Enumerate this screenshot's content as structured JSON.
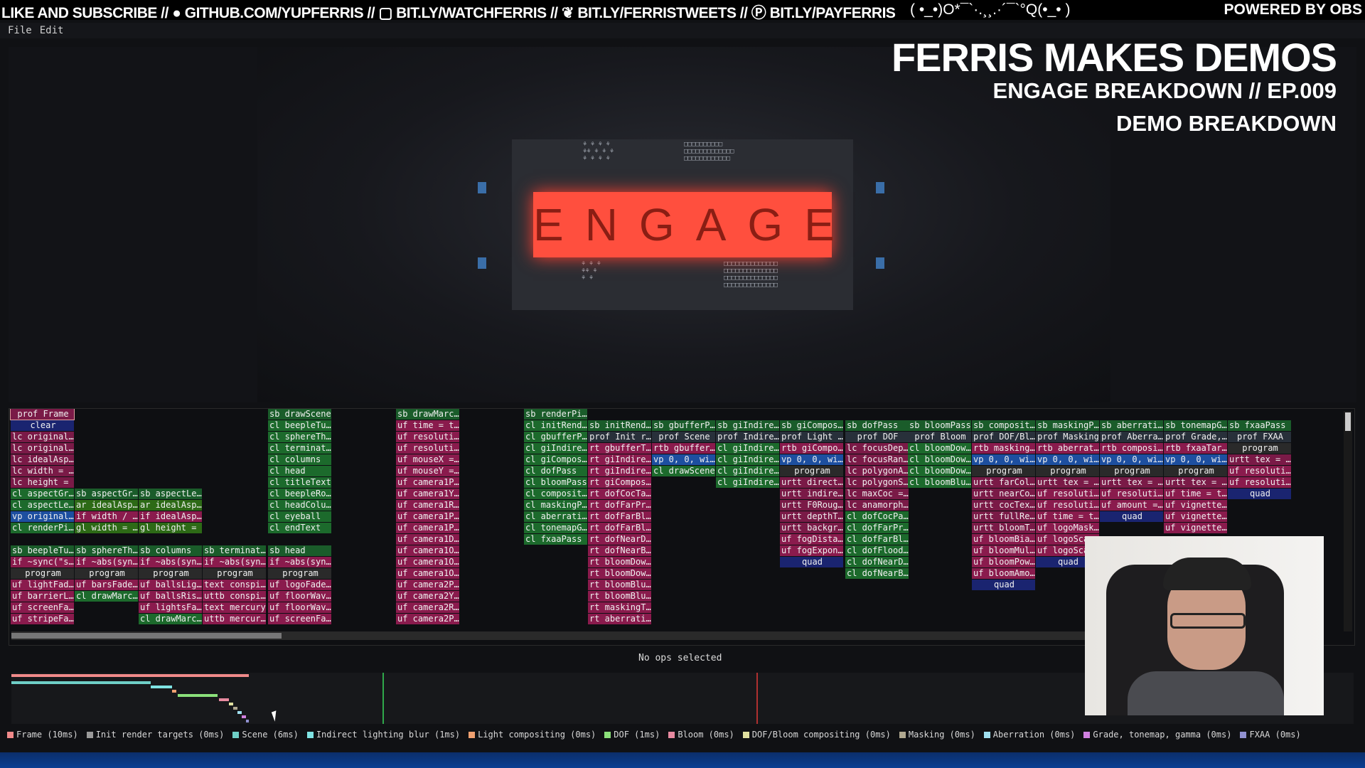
{
  "stream": {
    "left": "LIKE AND SUBSCRIBE // ● GITHUB.COM/YUPFERRIS // ▢ BIT.LY/WATCHFERRIS // ❦ BIT.LY/FERRISTWEETS // Ⓟ BIT.LY/PAYFERRIS",
    "center": "( •_•)O*¯`·.¸¸.·´¯`°Q(•_• )",
    "right": "POWERED BY OBS"
  },
  "menu": {
    "file": "File",
    "edit": "Edit"
  },
  "overlay": {
    "title": "FERRIS MAKES DEMOS",
    "subtitle": "ENGAGE BREAKDOWN // EP.009",
    "section": "DEMO BREAKDOWN"
  },
  "preview": {
    "logo": "ENGAGE"
  },
  "profiler": {
    "columns": [
      {
        "cells": [
          [
            "pf",
            "prof Frame"
          ],
          [
            "clear",
            "clear"
          ],
          [
            "lc",
            "lc original…"
          ],
          [
            "lc",
            "lc original…"
          ],
          [
            "lc",
            "lc idealAsp…"
          ],
          [
            "lc",
            "lc width = …"
          ],
          [
            "lc",
            "lc height = …"
          ],
          [
            "cl",
            "cl aspectGr…"
          ],
          [
            "cl",
            "cl aspectLe…"
          ],
          [
            "vp",
            "vp original…"
          ],
          [
            "cl",
            "cl renderPi…"
          ],
          [
            "blank",
            ""
          ],
          [
            "sb",
            "sb beepleTu…"
          ],
          [
            "uf",
            "if ~sync(\"s…"
          ],
          [
            "prog",
            "program"
          ],
          [
            "uf",
            "uf lightFad…"
          ],
          [
            "uf",
            "uf barrierL…"
          ],
          [
            "uf",
            "uf screenFa…"
          ],
          [
            "uf",
            "uf stripeFa…"
          ]
        ]
      },
      {
        "cells": [
          [
            "blank",
            ""
          ],
          [
            "blank",
            ""
          ],
          [
            "blank",
            ""
          ],
          [
            "blank",
            ""
          ],
          [
            "blank",
            ""
          ],
          [
            "blank",
            ""
          ],
          [
            "blank",
            ""
          ],
          [
            "sb",
            "sb aspectGr…"
          ],
          [
            "ar",
            "ar idealAsp…"
          ],
          [
            "uf",
            "if width / …"
          ],
          [
            "gl",
            "gl width = …"
          ],
          [
            "blank",
            ""
          ],
          [
            "sb",
            "sb sphereTh…"
          ],
          [
            "uf",
            "if ~abs(syn…"
          ],
          [
            "prog",
            "program"
          ],
          [
            "uf",
            "uf barsFade…"
          ],
          [
            "cl",
            "cl drawMarc…"
          ]
        ]
      },
      {
        "cells": [
          [
            "blank",
            ""
          ],
          [
            "blank",
            ""
          ],
          [
            "blank",
            ""
          ],
          [
            "blank",
            ""
          ],
          [
            "blank",
            ""
          ],
          [
            "blank",
            ""
          ],
          [
            "blank",
            ""
          ],
          [
            "sb",
            "sb aspectLe…"
          ],
          [
            "ar",
            "ar idealAsp…"
          ],
          [
            "uf",
            "if idealAsp…"
          ],
          [
            "gl",
            "gl height = …"
          ],
          [
            "blank",
            ""
          ],
          [
            "sb",
            "sb columns"
          ],
          [
            "uf",
            "if ~abs(syn…"
          ],
          [
            "prog",
            "program"
          ],
          [
            "uf",
            "uf ballsLig…"
          ],
          [
            "uf",
            "uf ballsRis…"
          ],
          [
            "uf",
            "uf lightsFa…"
          ],
          [
            "cl",
            "cl drawMarc…"
          ]
        ]
      },
      {
        "cells": [
          [
            "blank",
            ""
          ],
          [
            "blank",
            ""
          ],
          [
            "blank",
            ""
          ],
          [
            "blank",
            ""
          ],
          [
            "blank",
            ""
          ],
          [
            "blank",
            ""
          ],
          [
            "blank",
            ""
          ],
          [
            "blank",
            ""
          ],
          [
            "blank",
            ""
          ],
          [
            "blank",
            ""
          ],
          [
            "blank",
            ""
          ],
          [
            "blank",
            ""
          ],
          [
            "sb",
            "sb terminat…"
          ],
          [
            "uf",
            "if ~abs(syn…"
          ],
          [
            "prog",
            "program"
          ],
          [
            "uf",
            "text conspi…"
          ],
          [
            "uf",
            "uttb conspi…"
          ],
          [
            "uf",
            "text mercury"
          ],
          [
            "uf",
            "uttb mercur…"
          ]
        ]
      },
      {
        "cells": [
          [
            "sb",
            "sb drawScene"
          ],
          [
            "cl",
            "cl beepleTu…"
          ],
          [
            "cl",
            "cl sphereTh…"
          ],
          [
            "cl",
            "cl terminat…"
          ],
          [
            "cl",
            "cl columns"
          ],
          [
            "cl",
            "cl head"
          ],
          [
            "cl",
            "cl titleText"
          ],
          [
            "cl",
            "cl beepleRo…"
          ],
          [
            "cl",
            "cl headColu…"
          ],
          [
            "cl",
            "cl eyeball"
          ],
          [
            "cl",
            "cl endText"
          ],
          [
            "blank",
            ""
          ],
          [
            "sb",
            "sb head"
          ],
          [
            "uf",
            "if ~abs(syn…"
          ],
          [
            "prog",
            "program"
          ],
          [
            "uf",
            "uf logoFade…"
          ],
          [
            "uf",
            "uf floorWav…"
          ],
          [
            "uf",
            "uf floorWav…"
          ],
          [
            "uf",
            "uf screenFa…"
          ]
        ]
      },
      {
        "cells": []
      },
      {
        "cells": [
          [
            "sb",
            "sb drawMarc…"
          ],
          [
            "uf",
            "uf time = t…"
          ],
          [
            "uf",
            "uf resoluti…"
          ],
          [
            "uf",
            "uf resoluti…"
          ],
          [
            "uf",
            "uf mouseX =…"
          ],
          [
            "uf",
            "uf mouseY =…"
          ],
          [
            "uf",
            "uf camera1P…"
          ],
          [
            "uf",
            "uf camera1Y…"
          ],
          [
            "uf",
            "uf camera1R…"
          ],
          [
            "uf",
            "uf camera1P…"
          ],
          [
            "uf",
            "uf camera1P…"
          ],
          [
            "uf",
            "uf camera1D…"
          ],
          [
            "uf",
            "uf camera1O…"
          ],
          [
            "uf",
            "uf camera1O…"
          ],
          [
            "uf",
            "uf camera1O…"
          ],
          [
            "uf",
            "uf camera2P…"
          ],
          [
            "uf",
            "uf camera2Y…"
          ],
          [
            "uf",
            "uf camera2R…"
          ],
          [
            "uf",
            "uf camera2P…"
          ]
        ]
      },
      {
        "cells": []
      },
      {
        "cells": [
          [
            "sb",
            "sb renderPi…"
          ],
          [
            "cl",
            "cl initRend…"
          ],
          [
            "cl",
            "cl gbufferP…"
          ],
          [
            "cl",
            "cl giIndire…"
          ],
          [
            "cl",
            "cl giCompos…"
          ],
          [
            "cl",
            "cl dofPass"
          ],
          [
            "cl",
            "cl bloomPass"
          ],
          [
            "cl",
            "cl composit…"
          ],
          [
            "cl",
            "cl maskingP…"
          ],
          [
            "cl",
            "cl aberrati…"
          ],
          [
            "cl",
            "cl tonemapG…"
          ],
          [
            "cl",
            "cl fxaaPass"
          ]
        ]
      },
      {
        "cells": [
          [
            "blank",
            ""
          ],
          [
            "sb",
            "sb initRend…"
          ],
          [
            "prof",
            "prof Init r…"
          ],
          [
            "rt",
            "rt gbufferT…"
          ],
          [
            "rt",
            "rt giIndire…"
          ],
          [
            "rt",
            "rt giIndire…"
          ],
          [
            "rt",
            "rt giCompos…"
          ],
          [
            "rt",
            "rt dofCocTa…"
          ],
          [
            "rt",
            "rt dofFarPr…"
          ],
          [
            "rt",
            "rt dofFarBl…"
          ],
          [
            "rt",
            "rt dofFarBl…"
          ],
          [
            "rt",
            "rt dofNearD…"
          ],
          [
            "rt",
            "rt dofNearB…"
          ],
          [
            "rt",
            "rt bloomDow…"
          ],
          [
            "rt",
            "rt bloomDow…"
          ],
          [
            "rt",
            "rt bloomBlu…"
          ],
          [
            "rt",
            "rt bloomBlu…"
          ],
          [
            "rt",
            "rt maskingT…"
          ],
          [
            "rt",
            "rt aberrati…"
          ]
        ]
      },
      {
        "cells": [
          [
            "blank",
            ""
          ],
          [
            "sb",
            "sb gbufferP…"
          ],
          [
            "prof",
            "prof Scene"
          ],
          [
            "rt",
            "rtb gbuffer…"
          ],
          [
            "vp",
            "vp 0, 0, wi…"
          ],
          [
            "cl",
            "cl drawScene"
          ]
        ]
      },
      {
        "cells": [
          [
            "blank",
            ""
          ],
          [
            "sb",
            "sb giIndire…"
          ],
          [
            "prof",
            "prof Indire…"
          ],
          [
            "cl",
            "cl giIndire…"
          ],
          [
            "cl",
            "cl giIndire…"
          ],
          [
            "cl",
            "cl giIndire…"
          ],
          [
            "cl",
            "cl giIndire…"
          ]
        ]
      },
      {
        "cells": [
          [
            "blank",
            ""
          ],
          [
            "sb",
            "sb giCompos…"
          ],
          [
            "prof",
            "prof Light …"
          ],
          [
            "rt",
            "rtb giCompo…"
          ],
          [
            "vp",
            "vp 0, 0, wi…"
          ],
          [
            "prog",
            "program"
          ],
          [
            "urtt",
            "urtt direct…"
          ],
          [
            "urtt",
            "urtt indire…"
          ],
          [
            "urtt",
            "urtt F0Roug…"
          ],
          [
            "urtt",
            "urtt depthT…"
          ],
          [
            "urtt",
            "urtt backgr…"
          ],
          [
            "uf",
            "uf fogDista…"
          ],
          [
            "uf",
            "uf fogExpon…"
          ],
          [
            "quad",
            "quad"
          ]
        ]
      },
      {
        "cells": [
          [
            "blank",
            ""
          ],
          [
            "sb",
            "sb dofPass"
          ],
          [
            "prof",
            "prof DOF"
          ],
          [
            "lc",
            "lc focusDep…"
          ],
          [
            "lc",
            "lc focusRan…"
          ],
          [
            "lc",
            "lc polygonA…"
          ],
          [
            "lc",
            "lc polygonS…"
          ],
          [
            "lc",
            "lc maxCoc =…"
          ],
          [
            "lc",
            "lc anamorph…"
          ],
          [
            "cl",
            "cl dofCocPa…"
          ],
          [
            "cl",
            "cl dofFarPr…"
          ],
          [
            "cl",
            "cl dofFarBl…"
          ],
          [
            "cl",
            "cl dofFlood…"
          ],
          [
            "cl",
            "cl dofNearD…"
          ],
          [
            "cl",
            "cl dofNearB…"
          ]
        ]
      },
      {
        "cells": [
          [
            "blank",
            ""
          ],
          [
            "sb",
            "sb bloomPass"
          ],
          [
            "prof",
            "prof Bloom"
          ],
          [
            "cl",
            "cl bloomDow…"
          ],
          [
            "cl",
            "cl bloomDow…"
          ],
          [
            "cl",
            "cl bloomDow…"
          ],
          [
            "cl",
            "cl bloomBlu…"
          ]
        ]
      },
      {
        "cells": [
          [
            "blank",
            ""
          ],
          [
            "sb",
            "sb composit…"
          ],
          [
            "prof",
            "prof DOF/Bl…"
          ],
          [
            "rt",
            "rtb masking…"
          ],
          [
            "vp",
            "vp 0, 0, wi…"
          ],
          [
            "prog",
            "program"
          ],
          [
            "urtt",
            "urtt farCol…"
          ],
          [
            "urtt",
            "urtt nearCo…"
          ],
          [
            "urtt",
            "urtt cocTex…"
          ],
          [
            "urtt",
            "urtt fullRe…"
          ],
          [
            "urtt",
            "urtt bloomT…"
          ],
          [
            "uf",
            "uf bloomBia…"
          ],
          [
            "uf",
            "uf bloomMul…"
          ],
          [
            "uf",
            "uf bloomPow…"
          ],
          [
            "uf",
            "uf bloomAmo…"
          ],
          [
            "quad",
            "quad"
          ]
        ]
      },
      {
        "cells": [
          [
            "blank",
            ""
          ],
          [
            "sb",
            "sb maskingP…"
          ],
          [
            "prof",
            "prof Masking"
          ],
          [
            "rt",
            "rtb aberrat…"
          ],
          [
            "vp",
            "vp 0, 0, wi…"
          ],
          [
            "prog",
            "program"
          ],
          [
            "urtt",
            "urtt tex = …"
          ],
          [
            "uf",
            "uf resoluti…"
          ],
          [
            "uf",
            "uf resoluti…"
          ],
          [
            "uf",
            "uf time = t…"
          ],
          [
            "uf",
            "uf logoMask…"
          ],
          [
            "uf",
            "uf logoSca…"
          ],
          [
            "uf",
            "uf logoSca…"
          ],
          [
            "quad",
            "quad"
          ]
        ]
      },
      {
        "cells": [
          [
            "blank",
            ""
          ],
          [
            "sb",
            "sb aberrati…"
          ],
          [
            "prof",
            "prof Aberra…"
          ],
          [
            "rt",
            "rtb composi…"
          ],
          [
            "vp",
            "vp 0, 0, wi…"
          ],
          [
            "prog",
            "program"
          ],
          [
            "urtt",
            "urtt tex = …"
          ],
          [
            "uf",
            "uf resoluti…"
          ],
          [
            "uf",
            "uf amount =…"
          ],
          [
            "quad",
            "quad"
          ]
        ]
      },
      {
        "cells": [
          [
            "blank",
            ""
          ],
          [
            "sb",
            "sb tonemapG…"
          ],
          [
            "prof",
            "prof Grade,…"
          ],
          [
            "rt",
            "rtb fxaaTar…"
          ],
          [
            "vp",
            "vp 0, 0, wi…"
          ],
          [
            "prog",
            "program"
          ],
          [
            "urtt",
            "urtt tex = …"
          ],
          [
            "uf",
            "uf time = t…"
          ],
          [
            "uf",
            "uf vignette…"
          ],
          [
            "uf",
            "uf vignette…"
          ],
          [
            "uf",
            "uf vignette…"
          ]
        ]
      },
      {
        "cells": [
          [
            "blank",
            ""
          ],
          [
            "sb",
            "sb fxaaPass"
          ],
          [
            "prof",
            "prof FXAA"
          ],
          [
            "prog",
            "program"
          ],
          [
            "urtt",
            "urtt tex = …"
          ],
          [
            "uf",
            "uf resoluti…"
          ],
          [
            "uf",
            "uf resoluti…"
          ],
          [
            "quad",
            "quad"
          ]
        ]
      }
    ],
    "status": "No ops selected"
  },
  "legend": [
    {
      "label": "Frame (10ms)",
      "color": "#f08a8a"
    },
    {
      "label": "Init render targets (0ms)",
      "color": "#9a9a9a"
    },
    {
      "label": "Scene (6ms)",
      "color": "#6fcfc7"
    },
    {
      "label": "Indirect lighting blur (1ms)",
      "color": "#7fe3e3"
    },
    {
      "label": "Light compositing (0ms)",
      "color": "#f0a070"
    },
    {
      "label": "DOF (1ms)",
      "color": "#8be07a"
    },
    {
      "label": "Bloom (0ms)",
      "color": "#e88aa0"
    },
    {
      "label": "DOF/Bloom compositing (0ms)",
      "color": "#e0e0a0"
    },
    {
      "label": "Masking (0ms)",
      "color": "#b0a890"
    },
    {
      "label": "Aberration (0ms)",
      "color": "#a0e0f0"
    },
    {
      "label": "Grade, tonemap, gamma (0ms)",
      "color": "#d080e0"
    },
    {
      "label": "FXAA (0ms)",
      "color": "#9090d0"
    }
  ]
}
